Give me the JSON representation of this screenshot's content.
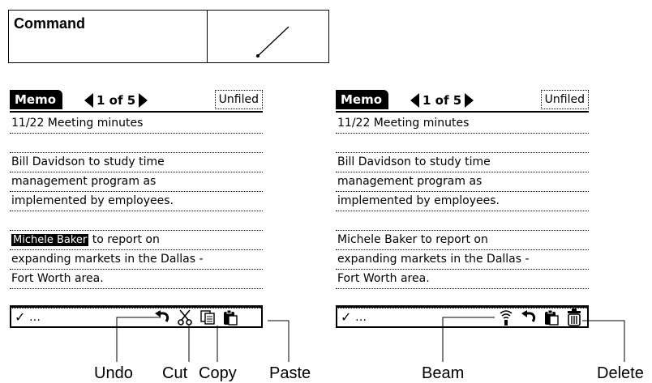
{
  "command_table": {
    "label": "Command"
  },
  "screens": [
    {
      "title": "Memo",
      "pager": "1 of 5",
      "category": "Unfiled",
      "lines": [
        "11/22 Meeting minutes",
        "",
        "Bill Davidson to study time",
        "management program as",
        "implemented by employees.",
        "",
        {
          "highlight": "Michele Baker",
          "rest": " to report on"
        },
        "expanding markets in the Dallas -",
        "Fort Worth area.",
        "",
        ""
      ],
      "toolbar_icons": [
        "undo-icon",
        "cut-icon",
        "copy-icon",
        "paste-icon"
      ]
    },
    {
      "title": "Memo",
      "pager": "1 of 5",
      "category": "Unfiled",
      "lines": [
        "11/22 Meeting minutes",
        "",
        "Bill Davidson to study time",
        "management program as",
        "implemented by employees.",
        "",
        "Michele Baker to report on",
        "expanding markets in the Dallas -",
        "Fort Worth area.",
        "",
        ""
      ],
      "toolbar_icons": [
        "beam-icon",
        "undo-icon",
        "paste-icon",
        "delete-icon"
      ]
    }
  ],
  "callouts": {
    "undo": "Undo",
    "cut": "Cut",
    "copy": "Copy",
    "paste": "Paste",
    "beam": "Beam",
    "delete": "Delete"
  }
}
